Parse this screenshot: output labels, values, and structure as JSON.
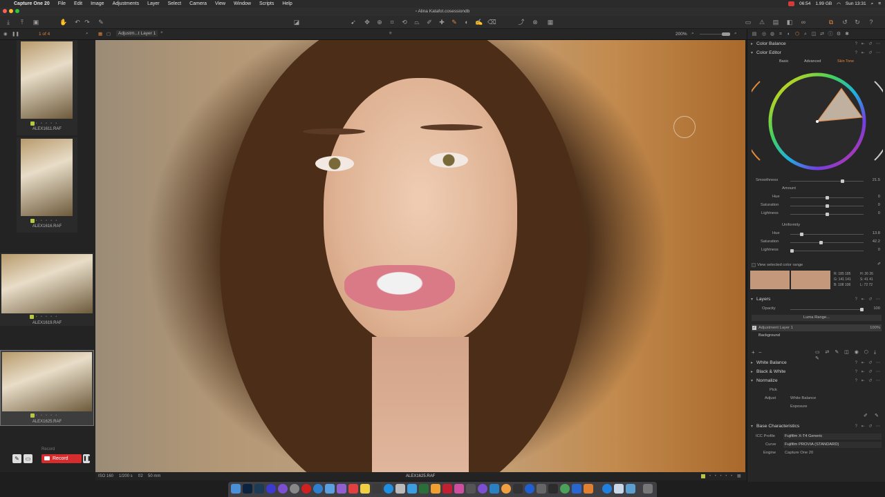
{
  "menubar": {
    "items": [
      "Capture One 20",
      "File",
      "Edit",
      "Image",
      "Adjustments",
      "Layer",
      "Select",
      "Camera",
      "View",
      "Window",
      "Scripts",
      "Help"
    ],
    "status": {
      "time_left": "06:54",
      "memory": "1.99 GB",
      "clock": "Sun 13:31"
    }
  },
  "window": {
    "title": "Alina Katafot.cosessiondb"
  },
  "subbar": {
    "count": "1 of 4",
    "layer_select": "Adjustm...t Layer 1",
    "zoom": "200%"
  },
  "browser": {
    "thumbnails": [
      {
        "name": "ALEX1611.RAF",
        "stars": "• • • • •"
      },
      {
        "name": "ALEX1616.RAF",
        "stars": "• • • • •"
      },
      {
        "name": "ALEX1619.RAF",
        "stars": "• • • • •"
      },
      {
        "name": "ALEX1625.RAF",
        "stars": "• • • • •"
      }
    ],
    "record_label": "Record",
    "record_button": "Record"
  },
  "statusbar": {
    "iso": "ISO 160",
    "shutter": "1/200 s",
    "aperture": "f/2",
    "focal": "50 mm",
    "filename": "ALEX1625.RAF"
  },
  "tools": {
    "color_balance": "Color Balance",
    "color_editor": {
      "title": "Color Editor",
      "tabs": [
        "Basic",
        "Advanced",
        "Skin Tone"
      ],
      "active_tab": "Skin Tone",
      "smoothness": {
        "label": "Smoothness",
        "value": "21.5",
        "pct": 0.72
      },
      "amount_header": "Amount",
      "amount": [
        {
          "label": "Hue",
          "value": "0",
          "pct": 0.5
        },
        {
          "label": "Saturation",
          "value": "0",
          "pct": 0.5
        },
        {
          "label": "Lightness",
          "value": "0",
          "pct": 0.5
        }
      ],
      "uniformity_header": "Uniformity",
      "uniformity": [
        {
          "label": "Hue",
          "value": "13.8",
          "pct": 0.14
        },
        {
          "label": "Saturation",
          "value": "42.2",
          "pct": 0.42
        },
        {
          "label": "Lightness",
          "value": "0",
          "pct": 0.0
        }
      ],
      "view_range": "View selected color range",
      "rgb": [
        "R: 185 185",
        "G: 141 141",
        "B: 108 108"
      ],
      "hsl": [
        "H: 26 26",
        "S: 41 41",
        "L: 72 72"
      ],
      "swatch_color": "#c4987a"
    },
    "layers": {
      "title": "Layers",
      "opacity_label": "Opacity",
      "opacity_value": "100",
      "luma_button": "Luma Range...",
      "rows": [
        {
          "name": "Adjustment Layer 1",
          "pct": "100%"
        },
        {
          "name": "Background"
        }
      ]
    },
    "white_balance": "White Balance",
    "black_white": "Black & White",
    "normalize": {
      "title": "Normalize",
      "pick": "Pick",
      "adjust": "Adjust",
      "opt1": "White Balance",
      "opt2": "Exposure"
    },
    "base": {
      "title": "Base Characteristics",
      "icc_label": "ICC Profile",
      "icc_value": "Fujifilm X-T4 Generic",
      "curve_label": "Curve",
      "curve_value": "Fujifilm PROVIA (STANDARD)",
      "engine_label": "Engine",
      "engine_value": "Capture One 20"
    }
  },
  "colors": {
    "accent": "#e4843b",
    "record": "#d52d2d",
    "tag": "#b8c840"
  }
}
